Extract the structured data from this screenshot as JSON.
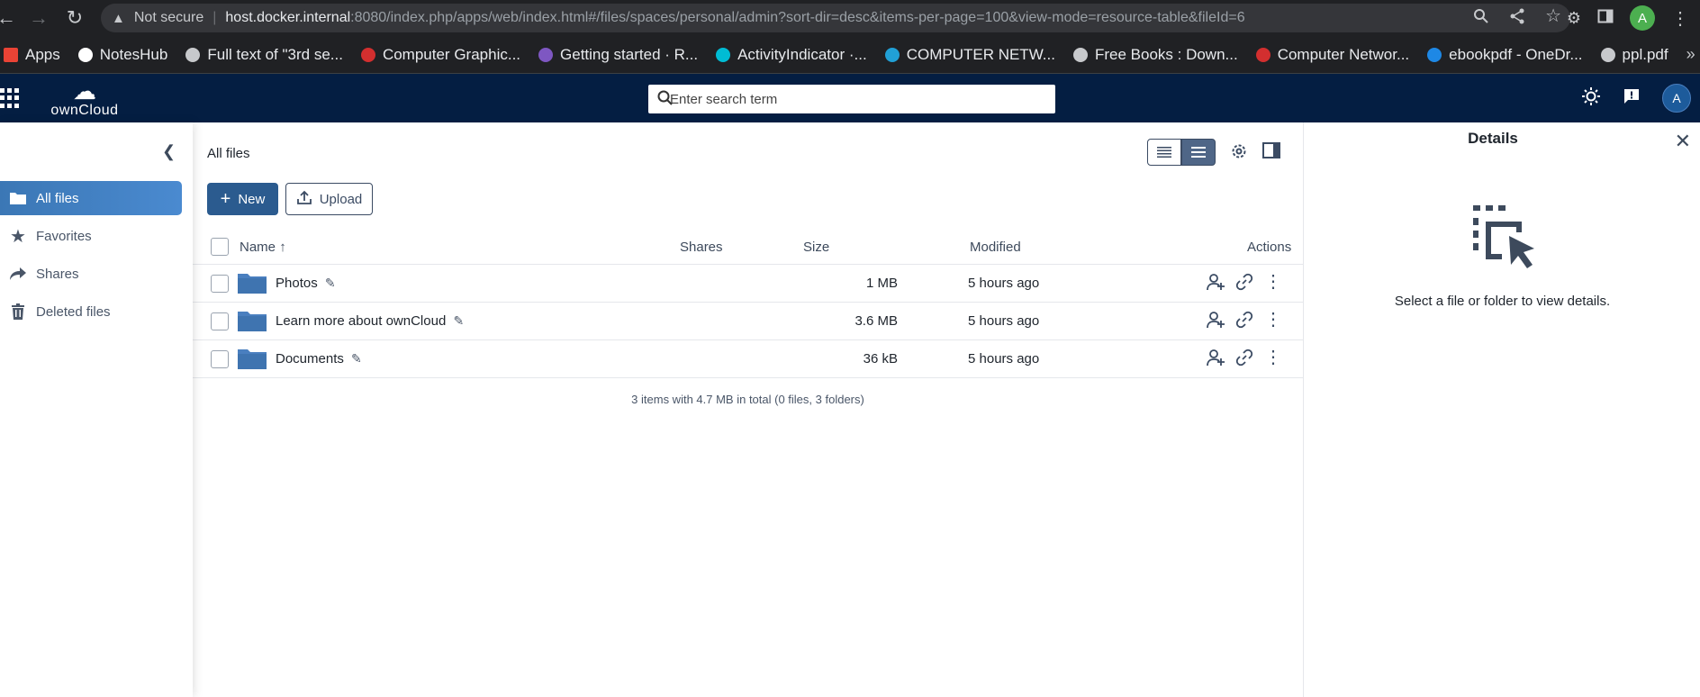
{
  "browser": {
    "not_secure": "Not secure",
    "url_host": "host.docker.internal",
    "url_path": ":8080/index.php/apps/web/index.html#/files/spaces/personal/admin?sort-dir=desc&items-per-page=100&view-mode=resource-table&fileId=6",
    "profile_initial": "A"
  },
  "bookmarks": [
    {
      "label": "Apps",
      "icon_color": "#ea4335"
    },
    {
      "label": "NotesHub",
      "icon_color": "#ffffff"
    },
    {
      "label": "Full text of \"3rd se...",
      "icon_color": "#c7c9cc"
    },
    {
      "label": "Computer Graphic...",
      "icon_color": "#d32f2f"
    },
    {
      "label": "Getting started · R...",
      "icon_color": "#7e57c2"
    },
    {
      "label": "ActivityIndicator ·...",
      "icon_color": "#00bcd4"
    },
    {
      "label": "COMPUTER NETW...",
      "icon_color": "#21a0d6"
    },
    {
      "label": "Free Books : Down...",
      "icon_color": "#c7c9cc"
    },
    {
      "label": "Computer Networ...",
      "icon_color": "#d32f2f"
    },
    {
      "label": "ebookpdf - OneDr...",
      "icon_color": "#1e88e5"
    },
    {
      "label": "ppl.pdf",
      "icon_color": "#c7c9cc"
    }
  ],
  "app": {
    "logo_text": "ownCloud",
    "search_placeholder": "Enter search term",
    "avatar_initial": "A"
  },
  "sidebar": {
    "items": [
      {
        "label": "All files",
        "active": true
      },
      {
        "label": "Favorites",
        "active": false
      },
      {
        "label": "Shares",
        "active": false
      },
      {
        "label": "Deleted files",
        "active": false
      }
    ]
  },
  "content": {
    "breadcrumb": "All files",
    "new_label": "New",
    "upload_label": "Upload",
    "columns": {
      "name": "Name",
      "shares": "Shares",
      "size": "Size",
      "modified": "Modified",
      "actions": "Actions"
    },
    "rows": [
      {
        "name": "Photos",
        "size": "1 MB",
        "modified": "5 hours ago"
      },
      {
        "name": "Learn more about ownCloud",
        "size": "3.6 MB",
        "modified": "5 hours ago"
      },
      {
        "name": "Documents",
        "size": "36 kB",
        "modified": "5 hours ago"
      }
    ],
    "summary": "3 items with 4.7 MB in total (0 files, 3 folders)"
  },
  "details": {
    "title": "Details",
    "empty_text": "Select a file or folder to view details."
  },
  "colors": {
    "topbar": "#041e42",
    "accent": "#2b5b8f",
    "folder": "#4a7fbf"
  }
}
